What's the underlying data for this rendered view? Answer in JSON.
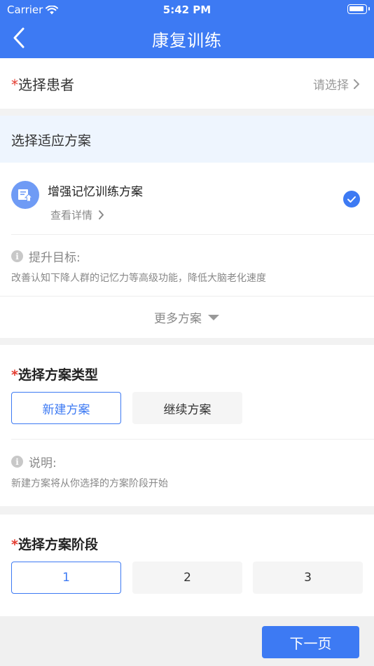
{
  "status_bar": {
    "carrier": "Carrier",
    "time": "5:42 PM"
  },
  "header": {
    "title": "康复训练"
  },
  "patient": {
    "required_mark": "*",
    "label": "选择患者",
    "placeholder": "请选择"
  },
  "plan_section": {
    "title": "选择适应方案",
    "plan": {
      "name": "增强记忆训练方案",
      "detail_link": "查看详情",
      "goal_label": "提升目标:",
      "goal_text": "改善认知下降人群的记忆力等高级功能，降低大脑老化速度"
    },
    "more": "更多方案"
  },
  "plan_type": {
    "required_mark": "*",
    "title": "选择方案类型",
    "options": [
      "新建方案",
      "继续方案"
    ],
    "selected": "新建方案",
    "note_label": "说明:",
    "note_text": "新建方案将从你选择的方案阶段开始"
  },
  "plan_stage": {
    "required_mark": "*",
    "title": "选择方案阶段",
    "options": [
      "1",
      "2",
      "3"
    ],
    "selected": "1"
  },
  "footer": {
    "next_label": "下一页"
  },
  "colors": {
    "primary": "#3d7af3",
    "required": "#e33a2e"
  }
}
